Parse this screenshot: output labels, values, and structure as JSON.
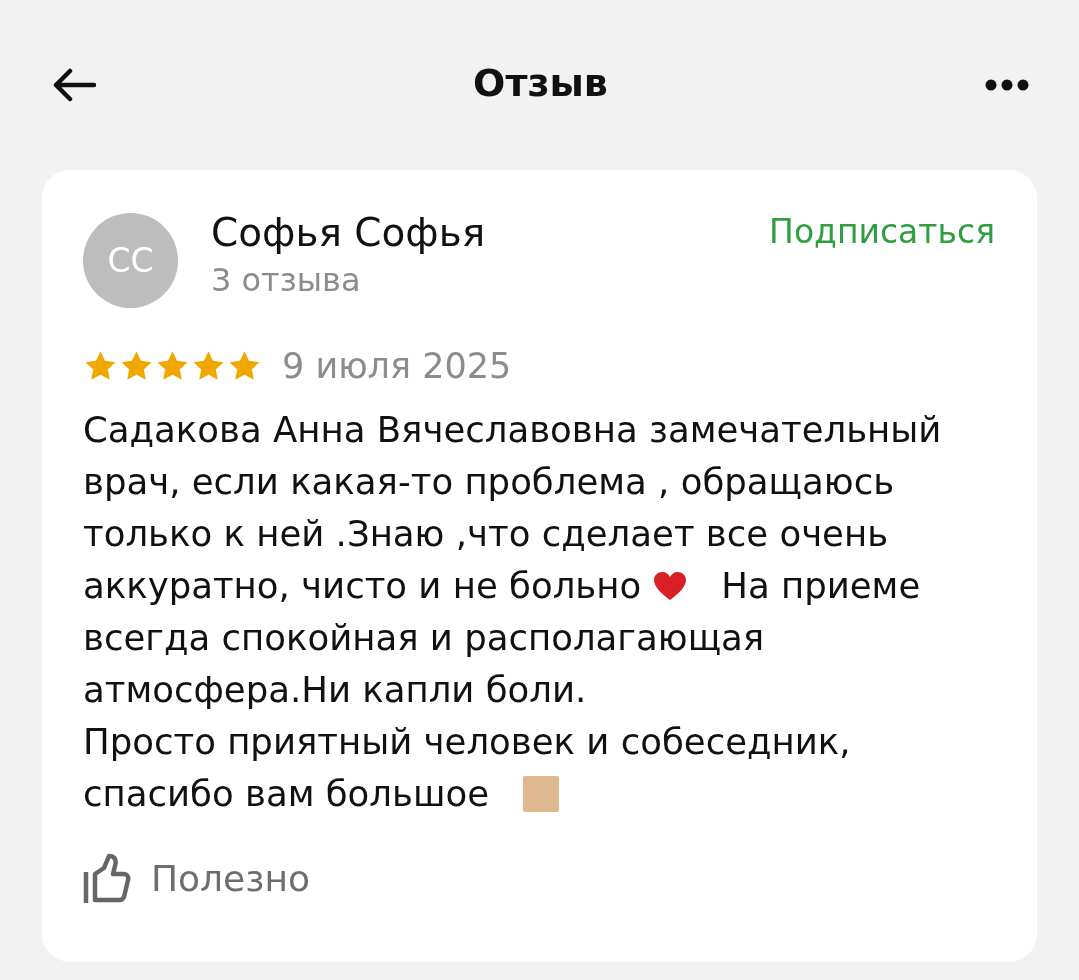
{
  "header": {
    "title": "Отзыв"
  },
  "review": {
    "author": {
      "initials": "СС",
      "name": "Софья Софья",
      "reviews_count": "3 отзыва"
    },
    "subscribe": "Подписаться",
    "stars": 5,
    "date": "9 июля 2025",
    "lines": [
      [
        {
          "kind": "text",
          "text": "Садакова Анна Вячеславовна замечательный"
        }
      ],
      [
        {
          "kind": "text",
          "text": "врач, если какая-то проблема , обращаюсь"
        }
      ],
      [
        {
          "kind": "text",
          "text": "только к ней .Знаю ,что сделает все очень"
        }
      ],
      [
        {
          "kind": "text",
          "text": "аккуратно, чисто и не больно"
        },
        {
          "kind": "heart"
        },
        {
          "kind": "text",
          "text": "На приеме"
        }
      ],
      [
        {
          "kind": "text",
          "text": "всегда спокойная и располагающая"
        }
      ],
      [
        {
          "kind": "text",
          "text": "атмосфера.Ни капли боли."
        }
      ],
      [
        {
          "kind": "text",
          "text": "Просто приятный человек и собеседник,"
        }
      ],
      [
        {
          "kind": "text",
          "text": "спасибо вам большое"
        },
        {
          "kind": "swatch"
        }
      ]
    ],
    "helpful": "Полезно"
  }
}
